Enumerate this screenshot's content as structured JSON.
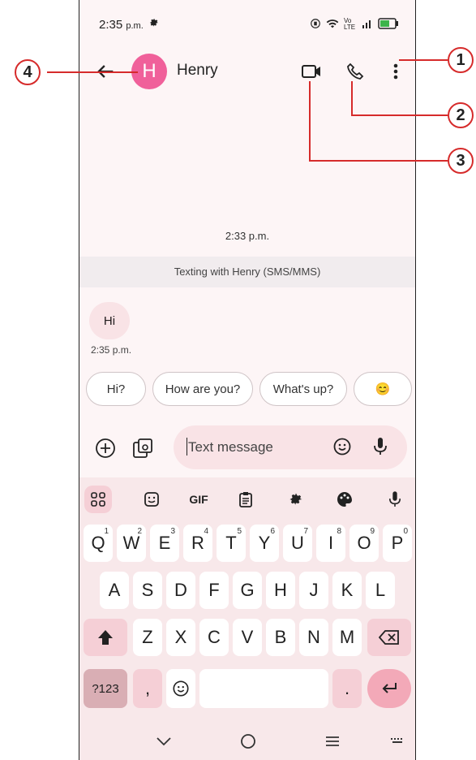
{
  "status": {
    "time": "2:35",
    "ampm": "p.m.",
    "net": "Vo LTE"
  },
  "appbar": {
    "avatar_letter": "H",
    "contact": "Henry"
  },
  "thread": {
    "timestamp": "2:33 p.m.",
    "banner": "Texting with Henry (SMS/MMS)",
    "message": {
      "text": "Hi",
      "time": "2:35 p.m."
    }
  },
  "chips": [
    "Hi?",
    "How are you?",
    "What's up?",
    "😊"
  ],
  "compose": {
    "placeholder": "Text message"
  },
  "keyboard": {
    "toolbar": {
      "gif": "GIF"
    },
    "row1": [
      {
        "k": "Q",
        "s": "1"
      },
      {
        "k": "W",
        "s": "2"
      },
      {
        "k": "E",
        "s": "3"
      },
      {
        "k": "R",
        "s": "4"
      },
      {
        "k": "T",
        "s": "5"
      },
      {
        "k": "Y",
        "s": "6"
      },
      {
        "k": "U",
        "s": "7"
      },
      {
        "k": "I",
        "s": "8"
      },
      {
        "k": "O",
        "s": "9"
      },
      {
        "k": "P",
        "s": "0"
      }
    ],
    "row2": [
      "A",
      "S",
      "D",
      "F",
      "G",
      "H",
      "J",
      "K",
      "L"
    ],
    "row3": [
      "Z",
      "X",
      "C",
      "V",
      "B",
      "N",
      "M"
    ],
    "sym": "?123",
    "comma": ",",
    "period": "."
  },
  "callouts": [
    "1",
    "2",
    "3",
    "4"
  ],
  "colors": {
    "accent": "#f0609a",
    "callout": "#d62b2b"
  }
}
